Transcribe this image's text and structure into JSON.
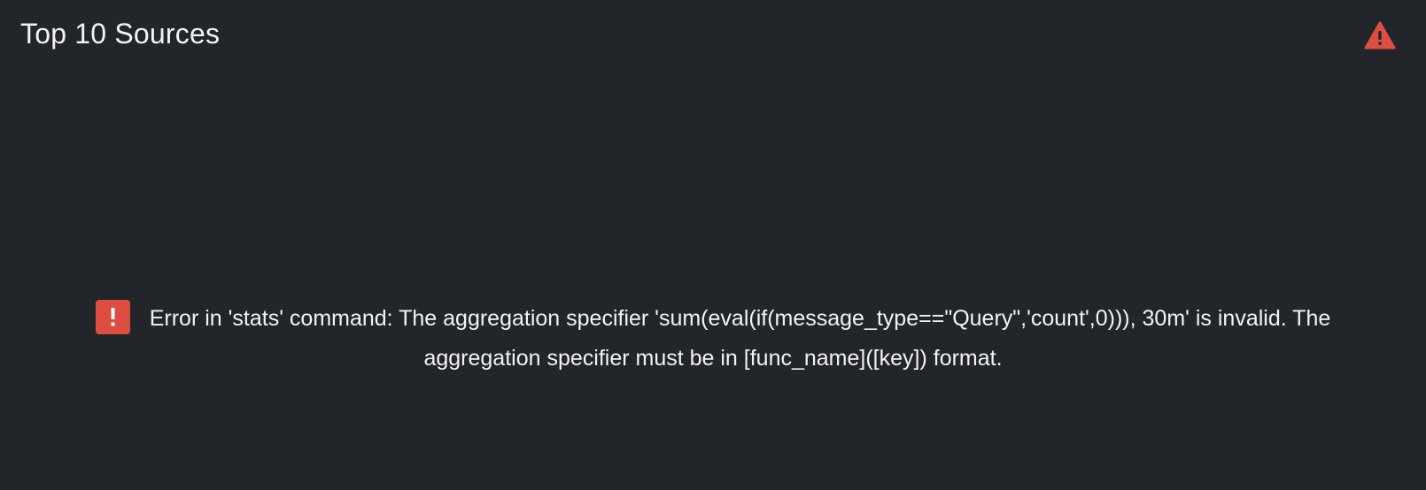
{
  "panel": {
    "title": "Top 10 Sources",
    "header_icon": "warning-triangle-icon"
  },
  "error": {
    "icon": "error-exclamation-icon",
    "message": "Error in 'stats' command: The aggregation specifier 'sum(eval(if(message_type==\"Query\",'count',0))), 30m' is invalid. The aggregation specifier must be in [func_name]([key]) format."
  },
  "colors": {
    "background": "#222529",
    "error_red": "#dc4e41",
    "text": "#f2f3f4"
  }
}
